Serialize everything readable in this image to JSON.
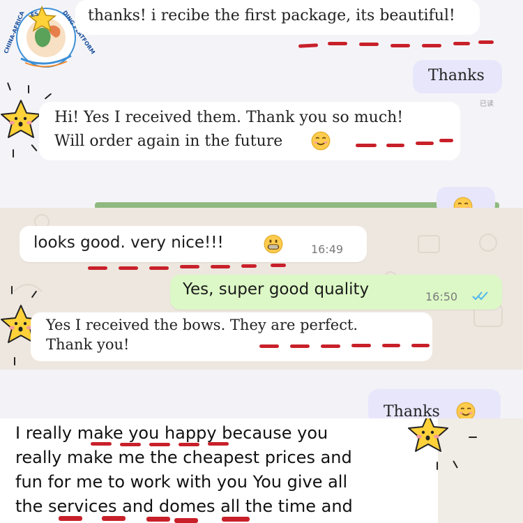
{
  "logo": {
    "ring_text": "CHINA-AFRICA",
    "ring_text_2": "ES",
    "ring_text_3": "DING PLATFORM"
  },
  "top_section": {
    "msg1": "thanks! i recibe the first package, its beautiful!",
    "msg2": "Thanks",
    "msg2_meta": "已读",
    "msg3_line1": "Hi! Yes I received them. Thank you so much!",
    "msg3_line2": "Will order again in the future"
  },
  "whatsapp_section": {
    "msg1": "looks good. very nice!!!",
    "msg1_time": "16:49",
    "msg2": "Yes, super good quality",
    "msg2_time": "16:50"
  },
  "mid_section": {
    "msg1_line1": "Yes I received the bows. They are perfect.",
    "msg1_line2": "Thank you!",
    "msg2": "Thanks"
  },
  "bottom_section": {
    "line1": "I really make you happy because you",
    "line2": "really make me the cheapest prices and",
    "line3": "fun for me to work with you You give all",
    "line4": "the services and domes all the time and"
  },
  "colors": {
    "accent_underline": "#c8202a",
    "whatsapp_sent": "#dcf8c6",
    "lavender_bubble": "#e8e6fb",
    "read_ticks": "#4fb6ec"
  },
  "icons": [
    "star-sticker-icon",
    "smile-emoji-icon",
    "grin-emoji-icon",
    "double-check-icon",
    "logo-icon"
  ]
}
